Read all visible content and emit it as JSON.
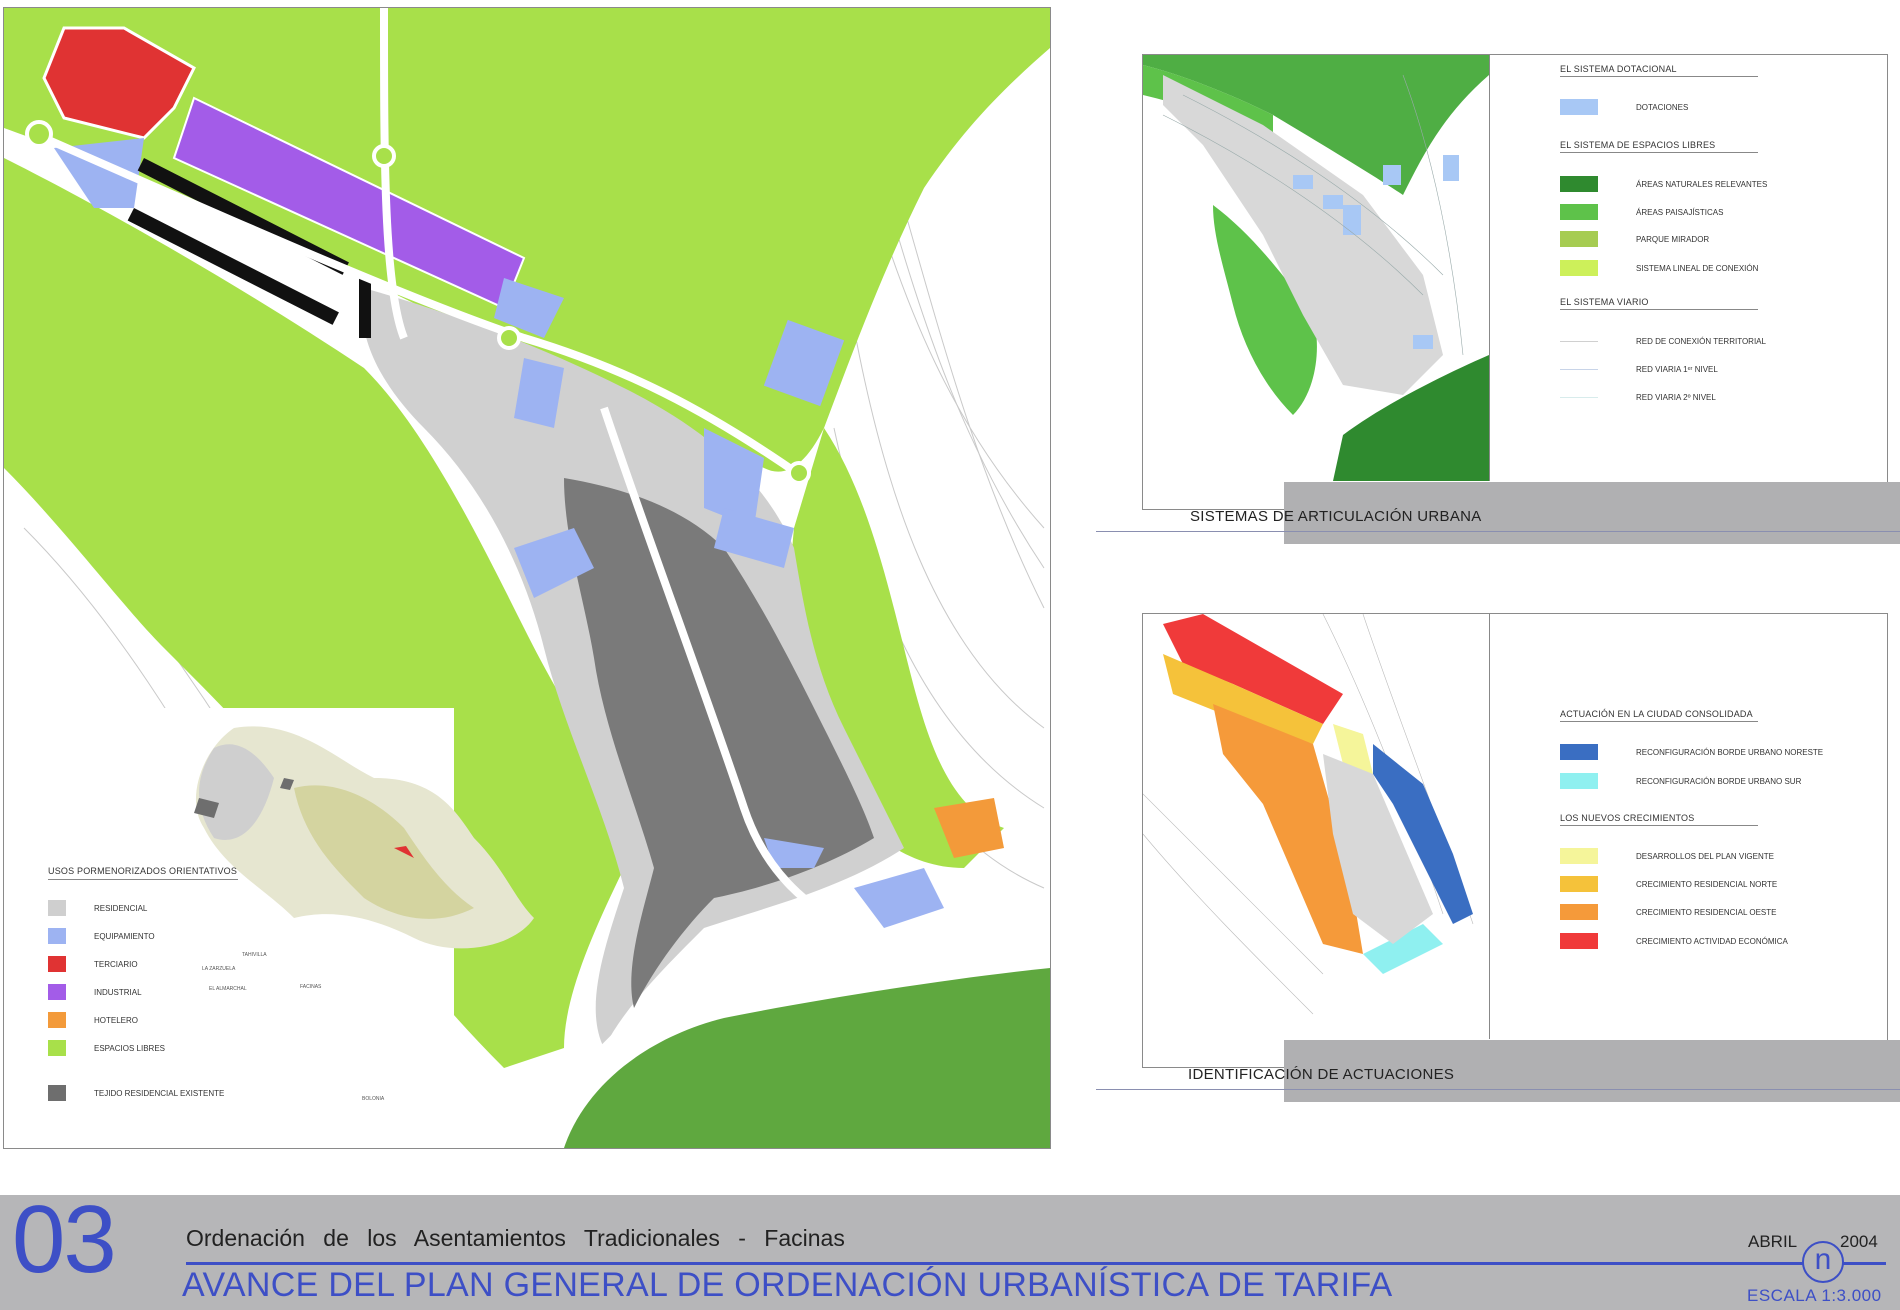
{
  "main_map": {
    "legend": {
      "title": "USOS PORMENORIZADOS ORIENTATIVOS",
      "items": [
        {
          "label": "RESIDENCIAL",
          "color": "#cfcfcf"
        },
        {
          "label": "EQUIPAMIENTO",
          "color": "#9db3f2"
        },
        {
          "label": "TERCIARIO",
          "color": "#e03333"
        },
        {
          "label": "INDUSTRIAL",
          "color": "#a35ce8"
        },
        {
          "label": "HOTELERO",
          "color": "#f39a3a"
        },
        {
          "label": "ESPACIOS LIBRES",
          "color": "#a8e04a"
        },
        {
          "label": "TEJIDO RESIDENCIAL EXISTENTE",
          "color": "#6e6e6e"
        }
      ]
    },
    "key_map_labels": [
      "LA ZARZUELA",
      "EL ALMARCHAL",
      "FACINAS",
      "TAHIVILLA",
      "BOLONIA"
    ]
  },
  "panel_top": {
    "title": "SISTEMAS DE ARTICULACIÓN URBANA",
    "groups": [
      {
        "heading": "EL SISTEMA DOTACIONAL",
        "items": [
          {
            "label": "DOTACIONES",
            "color": "#a8c8f5",
            "style": "box"
          }
        ]
      },
      {
        "heading": "EL SISTEMA DE ESPACIOS LIBRES",
        "items": [
          {
            "label": "ÁREAS NATURALES RELEVANTES",
            "color": "#2f8a2f",
            "style": "box"
          },
          {
            "label": "ÁREAS PAISAJÍSTICAS",
            "color": "#5ec24a",
            "style": "box"
          },
          {
            "label": "PARQUE MIRADOR",
            "color": "#a6cc52",
            "style": "box"
          },
          {
            "label": "SISTEMA LINEAL DE CONEXIÓN",
            "color": "#cdf05a",
            "style": "box"
          }
        ]
      },
      {
        "heading": "EL SISTEMA VIARIO",
        "items": [
          {
            "label": "RED DE CONEXIÓN TERRITORIAL",
            "color": "#d0d0d0",
            "style": "line"
          },
          {
            "label": "RED VIARIA 1ᵉʳ NIVEL",
            "color": "#c8d4e8",
            "style": "line"
          },
          {
            "label": "RED VIARIA 2º NIVEL",
            "color": "#d8ecec",
            "style": "line"
          }
        ]
      }
    ]
  },
  "panel_bottom": {
    "title": "IDENTIFICACIÓN DE ACTUACIONES",
    "groups": [
      {
        "heading": "ACTUACIÓN EN LA CIUDAD CONSOLIDADA",
        "items": [
          {
            "label": "RECONFIGURACIÓN BORDE URBANO NORESTE",
            "color": "#3a6ec2",
            "style": "box"
          },
          {
            "label": "RECONFIGURACIÓN BORDE URBANO SUR",
            "color": "#8ff0f0",
            "style": "box"
          }
        ]
      },
      {
        "heading": "LOS NUEVOS CRECIMIENTOS",
        "items": [
          {
            "label": "DESARROLLOS DEL PLAN VIGENTE",
            "color": "#f5f59a",
            "style": "box"
          },
          {
            "label": "CRECIMIENTO RESIDENCIAL NORTE",
            "color": "#f5c23a",
            "style": "box"
          },
          {
            "label": "CRECIMIENTO RESIDENCIAL OESTE",
            "color": "#f59a3a",
            "style": "box"
          },
          {
            "label": "CRECIMIENTO ACTIVIDAD ECONÓMICA",
            "color": "#f03a3a",
            "style": "box"
          }
        ]
      }
    ]
  },
  "footer": {
    "sheet_number": "03",
    "subtitle": "Ordenación de los Asentamientos Tradicionales - Facinas",
    "title": "AVANCE DEL PLAN GENERAL DE ORDENACIÓN URBANÍSTICA DE TARIFA",
    "month": "ABRIL",
    "year": "2004",
    "north_symbol": "n",
    "scale": "ESCALA 1:3.000"
  },
  "colors": {
    "accent_blue": "#3d4fc6",
    "footer_gray": "#b6b6b8",
    "light_green": "#a8e04a",
    "dark_green": "#5fa83f"
  }
}
